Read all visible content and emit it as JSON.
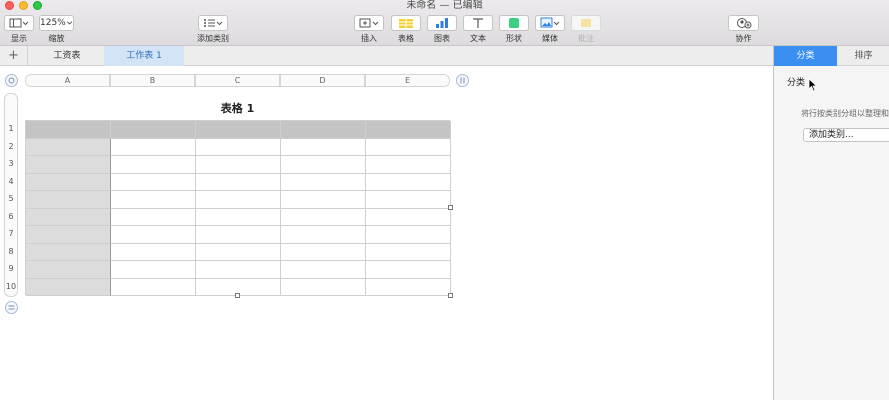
{
  "window": {
    "title": "未命名 — 已编辑"
  },
  "toolbar": {
    "display_label": "显示",
    "zoom_value": "125%",
    "zoom_label": "缩放",
    "add_category_label": "添加类别",
    "insert_label": "插入",
    "table_label": "表格",
    "chart_label": "图表",
    "text_label": "文本",
    "shape_label": "形状",
    "media_label": "媒体",
    "comment_label": "批注",
    "collaborate_label": "协作"
  },
  "sheets": {
    "add_symbol": "+",
    "tabs": [
      {
        "label": "工资表"
      },
      {
        "label": "工作表 1"
      }
    ]
  },
  "table": {
    "title": "表格 1",
    "columns": [
      "A",
      "B",
      "C",
      "D",
      "E"
    ],
    "rows": [
      "1",
      "2",
      "3",
      "4",
      "5",
      "6",
      "7",
      "8",
      "9",
      "10"
    ]
  },
  "sidebar": {
    "tabs": [
      {
        "label": "分类",
        "active": true
      },
      {
        "label": "排序",
        "active": false
      }
    ],
    "title": "分类",
    "description": "将行按类别分组以整理和",
    "add_button": "添加类别..."
  },
  "colors": {
    "accent": "#3a8ff0",
    "header_fill": "#c4c4c4",
    "header_column_fill": "#dcdcdc",
    "active_sheet_fill": "#d3e4f7"
  }
}
